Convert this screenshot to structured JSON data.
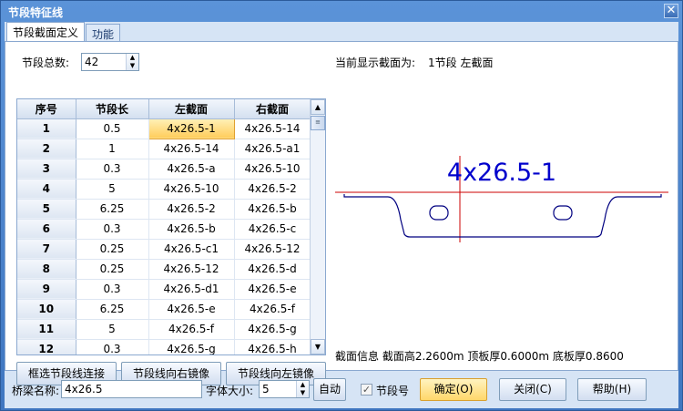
{
  "window": {
    "title": "节段特征线",
    "close_glyph": "✕"
  },
  "tabs": [
    {
      "label": "节段截面定义"
    },
    {
      "label": "功能"
    }
  ],
  "segment_count": {
    "label": "节段总数:",
    "value": "42"
  },
  "current_display": {
    "label": "当前显示截面为:",
    "value": "1节段 左截面"
  },
  "table": {
    "headers": [
      "序号",
      "节段长",
      "左截面",
      "右截面"
    ],
    "rows": [
      [
        "1",
        "0.5",
        "4x26.5-1",
        "4x26.5-14"
      ],
      [
        "2",
        "1",
        "4x26.5-14",
        "4x26.5-a1"
      ],
      [
        "3",
        "0.3",
        "4x26.5-a",
        "4x26.5-10"
      ],
      [
        "4",
        "5",
        "4x26.5-10",
        "4x26.5-2"
      ],
      [
        "5",
        "6.25",
        "4x26.5-2",
        "4x26.5-b"
      ],
      [
        "6",
        "0.3",
        "4x26.5-b",
        "4x26.5-c"
      ],
      [
        "7",
        "0.25",
        "4x26.5-c1",
        "4x26.5-12"
      ],
      [
        "8",
        "0.25",
        "4x26.5-12",
        "4x26.5-d"
      ],
      [
        "9",
        "0.3",
        "4x26.5-d1",
        "4x26.5-e"
      ],
      [
        "10",
        "6.25",
        "4x26.5-e",
        "4x26.5-f"
      ],
      [
        "11",
        "5",
        "4x26.5-f",
        "4x26.5-g"
      ],
      [
        "12",
        "0.3",
        "4x26.5-g",
        "4x26.5-h"
      ]
    ]
  },
  "actions": {
    "connect": "框选节段线连接",
    "mirror_right": "节段线向右镜像",
    "mirror_left": "节段线向左镜像"
  },
  "preview": {
    "section_name": "4x26.5-1",
    "line_color": "#000080",
    "axis_color": "#cc0000"
  },
  "section_info": {
    "label": "截面信息",
    "height": "截面高2.2600m",
    "top_thickness": "顶板厚0.6000m",
    "bottom_thickness": "底板厚0.8600"
  },
  "bottom": {
    "bridge_name_label": "桥梁名称:",
    "bridge_name_value": "4x26.5",
    "font_size_label": "字体大小:",
    "font_size_value": "5",
    "auto_button": "自动",
    "segment_no_label": "节段号",
    "segment_no_checked": "✓",
    "ok_button": "确定(O)",
    "close_button": "关闭(C)",
    "help_button": "帮助(H)"
  },
  "colors": {
    "accent": "#ffcc5a",
    "header_blue": "#4a7fc4"
  }
}
